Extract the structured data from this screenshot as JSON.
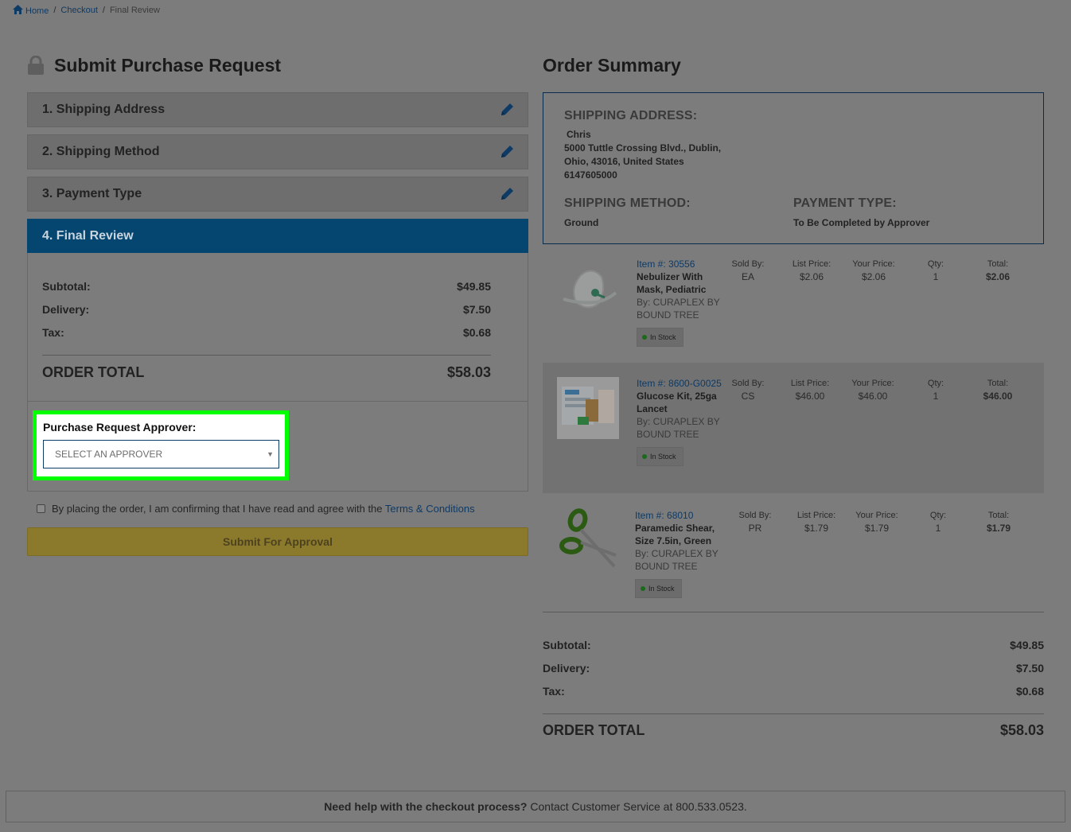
{
  "breadcrumb": {
    "home": "Home",
    "checkout": "Checkout",
    "current": "Final Review",
    "separator": "/"
  },
  "left": {
    "title": "Submit Purchase Request",
    "steps": [
      {
        "label": "1. Shipping Address"
      },
      {
        "label": "2. Shipping Method"
      },
      {
        "label": "3. Payment Type"
      },
      {
        "label": "4. Final Review"
      }
    ],
    "summary": {
      "subtotal_label": "Subtotal:",
      "subtotal": "$49.85",
      "delivery_label": "Delivery:",
      "delivery": "$7.50",
      "tax_label": "Tax:",
      "tax": "$0.68",
      "total_label": "ORDER TOTAL",
      "total": "$58.03"
    },
    "approver": {
      "label": "Purchase Request Approver:",
      "selected": "SELECT AN APPROVER"
    },
    "agree": {
      "text": "By placing the order, I am confirming that I have read and agree with the",
      "link": "Terms & Conditions"
    },
    "submit_label": "Submit For Approval"
  },
  "right": {
    "title": "Order Summary",
    "shipping_address_head": "SHIPPING ADDRESS:",
    "address": {
      "name": "Chris",
      "line1": "5000 Tuttle Crossing Blvd.,  Dublin,",
      "line2": "Ohio,  43016,  United States",
      "phone": "6147605000"
    },
    "shipping_method_head": "SHIPPING METHOD:",
    "shipping_method": "Ground",
    "payment_type_head": "PAYMENT TYPE:",
    "payment_type": "To Be Completed by Approver",
    "col_labels": {
      "sold_by": "Sold By:",
      "list_price": "List Price:",
      "your_price": "Your Price:",
      "qty": "Qty:",
      "total": "Total:"
    },
    "items": [
      {
        "num_label": "Item #:",
        "num": "30556",
        "name": "Nebulizer With Mask, Pediatric",
        "by": "By: CURAPLEX BY BOUND TREE",
        "sold_by": "EA",
        "list_price": "$2.06",
        "your_price": "$2.06",
        "qty": "1",
        "total": "$2.06",
        "stock": "In Stock",
        "icon": "nebulizer-mask-icon"
      },
      {
        "num_label": "Item #:",
        "num": "8600-G0025",
        "name": "Glucose Kit, 25ga Lancet",
        "by": "By: CURAPLEX BY BOUND TREE",
        "sold_by": "CS",
        "list_price": "$46.00",
        "your_price": "$46.00",
        "qty": "1",
        "total": "$46.00",
        "stock": "In Stock",
        "icon": "glucose-kit-icon"
      },
      {
        "num_label": "Item #:",
        "num": "68010",
        "name": "Paramedic Shear, Size 7.5in, Green",
        "by": "By: CURAPLEX BY BOUND TREE",
        "sold_by": "PR",
        "list_price": "$1.79",
        "your_price": "$1.79",
        "qty": "1",
        "total": "$1.79",
        "stock": "In Stock",
        "icon": "scissors-icon"
      }
    ],
    "summary": {
      "subtotal_label": "Subtotal:",
      "subtotal": "$49.85",
      "delivery_label": "Delivery:",
      "delivery": "$7.50",
      "tax_label": "Tax:",
      "tax": "$0.68",
      "total_label": "ORDER TOTAL",
      "total": "$58.03"
    }
  },
  "footer": {
    "bold": "Need help with the checkout process?",
    "text": "Contact Customer Service at 800.533.0523."
  },
  "colors": {
    "overlay": "#7c7c7c",
    "active_step": "#04466f",
    "highlight": "#00ff00",
    "submit": "#8c7a2c"
  }
}
